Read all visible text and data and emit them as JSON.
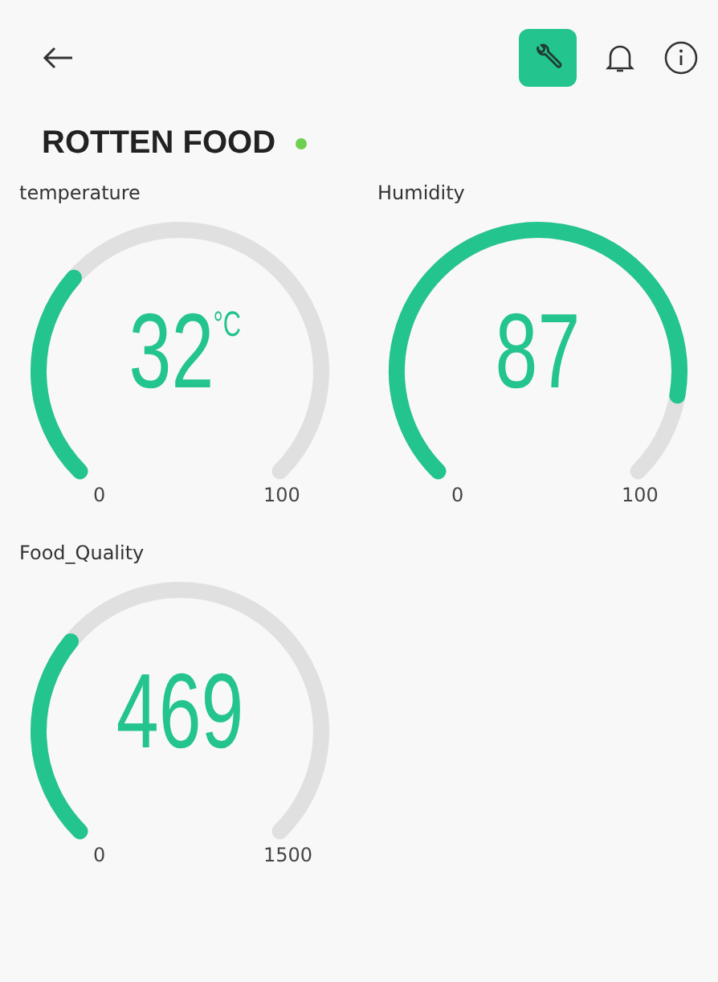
{
  "header": {
    "title": "ROTTEN FOOD",
    "online": true,
    "settings_active": true
  },
  "gauges": [
    {
      "label": "temperature",
      "value": "32",
      "unit": "°C",
      "min": "0",
      "max": "100"
    },
    {
      "label": "Humidity",
      "value": "87",
      "max": "100",
      "min": "0"
    },
    {
      "label": "Food_Quality",
      "value": "469",
      "min": "0",
      "max": "1500"
    }
  ]
}
